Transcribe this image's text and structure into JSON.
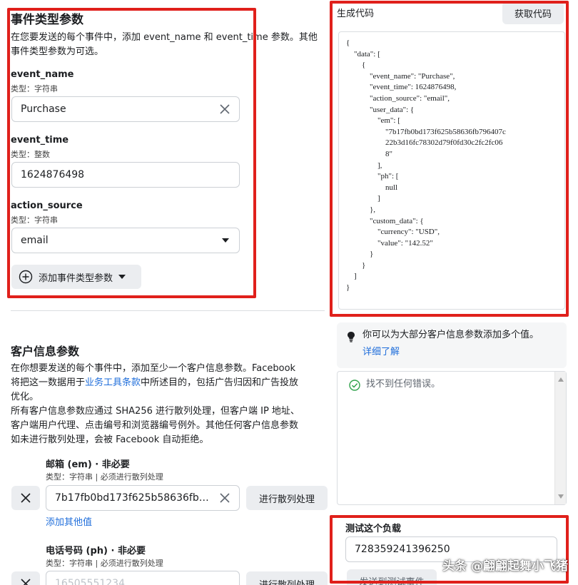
{
  "event_section": {
    "title": "事件类型参数",
    "desc_line1": "在您要发送的每个事件中，添加 event_name 和 event_time 参数。其他",
    "desc_line2": "事件类型参数为可选。",
    "fields": [
      {
        "name": "event_name",
        "type": "类型：字符串",
        "value": "Purchase"
      },
      {
        "name": "event_time",
        "type": "类型：整数",
        "value": "1624876498"
      },
      {
        "name": "action_source",
        "type": "类型：字符串",
        "value": "email"
      }
    ],
    "add_button": "添加事件类型参数"
  },
  "customer_section": {
    "title": "客户信息参数",
    "desc_line1": "在你想要发送的每个事件中，添加至少一个客户信息参数。Facebook",
    "desc_line2_pre": "将把这一数据用于",
    "desc_line2_link": "业务工具条款",
    "desc_line2_post": "中所述目的，包括广告归因和广告投放",
    "desc_line3": "优化。",
    "desc_line4": "所有客户信息参数应通过 SHA256 进行散列处理，但客户端 IP 地址、",
    "desc_line5": "客户端用户代理、点击编号和浏览器编号例外。其他任何客户信息参数",
    "desc_line6": "如未进行散列处理，会被 Facebook 自动拒绝。",
    "email": {
      "label": "邮箱 (em) · 非必要",
      "type": "类型：字符串 | 必须进行散列处理",
      "value": "7b17fb0bd173f625b58636fb79…",
      "hash_button": "进行散列处理",
      "add_other": "添加其他值"
    },
    "phone": {
      "label": "电话号码 (ph) · 非必要",
      "type": "类型：字符串 | 必须进行散列处理",
      "placeholder": "16505551234",
      "hash_button": "进行散列处理"
    }
  },
  "code_panel": {
    "title": "生成代码",
    "get_code_button": "获取代码",
    "code": "{\n    \"data\": [\n        {\n            \"event_name\": \"Purchase\",\n            \"event_time\": 1624876498,\n            \"action_source\": \"email\",\n            \"user_data\": {\n                \"em\": [\n                    \"7b17fb0bd173f625b58636fb796407c\n                    22b3d16fc78302d79f0fd30c2fc2fc06\n                    8\"\n                ],\n                \"ph\": [\n                    null\n                ]\n            },\n            \"custom_data\": {\n                \"currency\": \"USD\",\n                \"value\": \"142.52\"\n            }\n        }\n    ]\n}"
  },
  "tip": {
    "text": "你可以为大部分客户信息参数添加多个值。",
    "link": "详细了解"
  },
  "errors": {
    "text": "找不到任何错误。"
  },
  "test_payload": {
    "title": "测试这个负载",
    "value": "728359241396250",
    "send_button": "发送到测试事件"
  },
  "watermark": "头条 @翩翩起舞小飞猪",
  "colors": {
    "highlight_red": "#e0201b",
    "link_blue": "#216fdb",
    "success_green": "#31a24c"
  }
}
